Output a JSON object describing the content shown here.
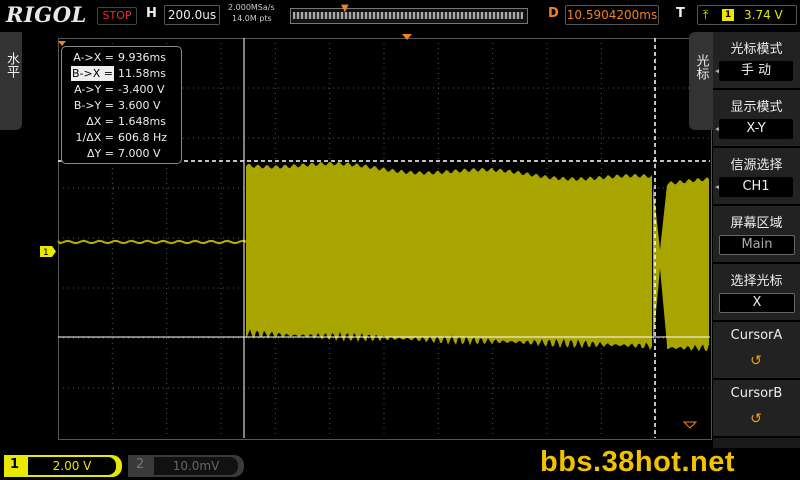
{
  "header": {
    "logo": "RIGOL",
    "run_state": "STOP",
    "timebase_label": "H",
    "timebase": "200.0us",
    "sample_rate": "2.000MSa/s",
    "memory_depth": "14.0M pts",
    "delay_label": "D",
    "delay": "10.5904200ms",
    "trigger_label": "T",
    "trigger_channel": "1",
    "trigger_level": "3.74 V"
  },
  "left_tab": {
    "label": "水平"
  },
  "cursor_readout": [
    {
      "label": "A->X =",
      "value": "9.936ms"
    },
    {
      "label": "B->X =",
      "value": "11.58ms",
      "highlight": true
    },
    {
      "label": "A->Y =",
      "value": "-3.400 V"
    },
    {
      "label": "B->Y =",
      "value": "3.600 V"
    },
    {
      "label": "ΔX =",
      "value": "1.648ms"
    },
    {
      "label": "1/ΔX =",
      "value": "606.8 Hz"
    },
    {
      "label": "ΔY =",
      "value": "7.000 V"
    }
  ],
  "menu": {
    "tab_label": "光标",
    "items": [
      {
        "title": "光标模式",
        "value": "手  动"
      },
      {
        "title": "显示模式",
        "value": "X-Y"
      },
      {
        "title": "信源选择",
        "value": "CH1"
      },
      {
        "title": "屏幕区域",
        "value": "Main"
      },
      {
        "title": "选择光标",
        "value": "X"
      },
      {
        "title": "CursorA",
        "value": "↺"
      },
      {
        "title": "CursorB",
        "value": "↺"
      }
    ]
  },
  "footer": {
    "ch1_number": "1",
    "ch1_scale": "2.00 V",
    "ch2_number": "2",
    "ch2_scale": "10.0mV",
    "watermark": "bbs.38hot.net"
  },
  "channel_marker": "1",
  "colors": {
    "ch1": "#b4b000",
    "trigger": "#f08020",
    "cursor": "#ffffff"
  }
}
